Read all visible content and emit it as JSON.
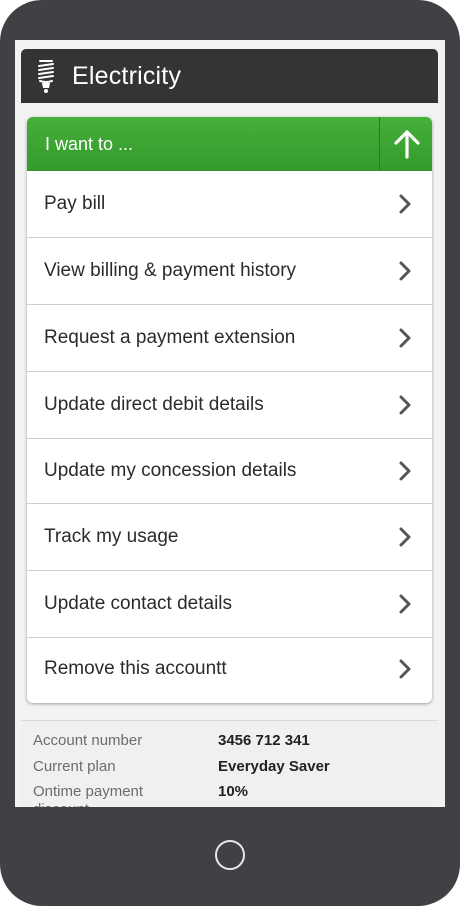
{
  "app": {
    "title": "Electricity",
    "icon": "lightbulb-icon",
    "header_color": "#333435"
  },
  "menu": {
    "header_label": "I want to ...",
    "accent_color": "#3fa535",
    "collapse_icon": "arrow-up-icon",
    "items": [
      {
        "label": "Pay bill",
        "icon": "chevron-right-icon"
      },
      {
        "label": "View billing & payment history",
        "icon": "chevron-right-icon"
      },
      {
        "label": "Request a payment extension",
        "icon": "chevron-right-icon"
      },
      {
        "label": "Update direct debit details",
        "icon": "chevron-right-icon"
      },
      {
        "label": "Update my concession details",
        "icon": "chevron-right-icon"
      },
      {
        "label": "Track my usage",
        "icon": "chevron-right-icon"
      },
      {
        "label": "Update contact details",
        "icon": "chevron-right-icon"
      },
      {
        "label": "Remove this accountt",
        "icon": "chevron-right-icon"
      }
    ]
  },
  "account": {
    "rows": [
      {
        "label": "Account number",
        "value": "3456 712 341"
      },
      {
        "label": "Current plan",
        "value": "Everyday Saver"
      },
      {
        "label": "Ontime payment discount",
        "value": "10%"
      }
    ]
  },
  "device": {
    "frame_color": "#404144",
    "home_button_icon": "home-button-icon"
  }
}
